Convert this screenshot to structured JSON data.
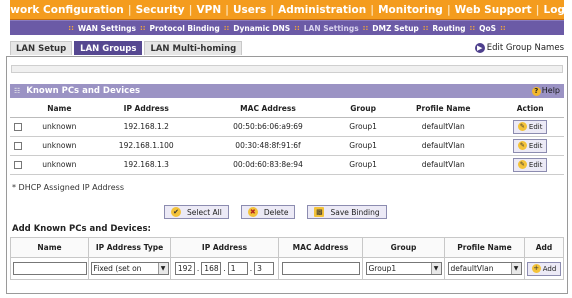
{
  "topnav": {
    "items": [
      "Network Configuration",
      "Security",
      "VPN",
      "Users",
      "Administration",
      "Monitoring",
      "Web Support",
      "Logout"
    ]
  },
  "subnav": {
    "items": [
      "WAN Settings",
      "Protocol Binding",
      "Dynamic DNS",
      "LAN Settings",
      "DMZ Setup",
      "Routing",
      "QoS"
    ],
    "active": "LAN Settings"
  },
  "tabs": [
    "LAN Setup",
    "LAN Groups",
    "LAN Multi-homing"
  ],
  "active_tab": "LAN Groups",
  "edit_group_names": "Edit Group Names",
  "known": {
    "title": "Known PCs and Devices",
    "help": "Help",
    "columns": [
      "",
      "Name",
      "IP Address",
      "MAC Address",
      "Group",
      "Profile Name",
      "Action"
    ],
    "rows": [
      {
        "name": "unknown",
        "ip": "192.168.1.2",
        "mac": "00:50:b6:06:a9:69",
        "group": "Group1",
        "profile": "defaultVlan",
        "action": "Edit"
      },
      {
        "name": "unknown",
        "ip": "192.168.1.100",
        "mac": "00:30:48:8f:91:6f",
        "group": "Group1",
        "profile": "defaultVlan",
        "action": "Edit"
      },
      {
        "name": "unknown",
        "ip": "192.168.1.3",
        "mac": "00:0d:60:83:8e:94",
        "group": "Group1",
        "profile": "defaultVlan",
        "action": "Edit"
      }
    ]
  },
  "dhcp_note": "* DHCP Assigned IP Address",
  "buttons": {
    "select_all": "Select All",
    "delete": "Delete",
    "save_binding": "Save Binding"
  },
  "add": {
    "title": "Add Known PCs and Devices:",
    "columns": [
      "Name",
      "IP Address Type",
      "IP Address",
      "MAC Address",
      "Group",
      "Profile Name",
      "Add"
    ],
    "name_value": "",
    "ip_type": "Fixed (set on",
    "ip_octets": [
      "192",
      "168",
      "1",
      "3"
    ],
    "mac_value": "",
    "group": "Group1",
    "profile": "defaultVlan",
    "add_label": "Add"
  },
  "colors": {
    "nav_orange": "#f49c1e",
    "subnav_purple": "#6b5aa6",
    "section_header": "#9b93c4",
    "active_tab": "#564891"
  }
}
